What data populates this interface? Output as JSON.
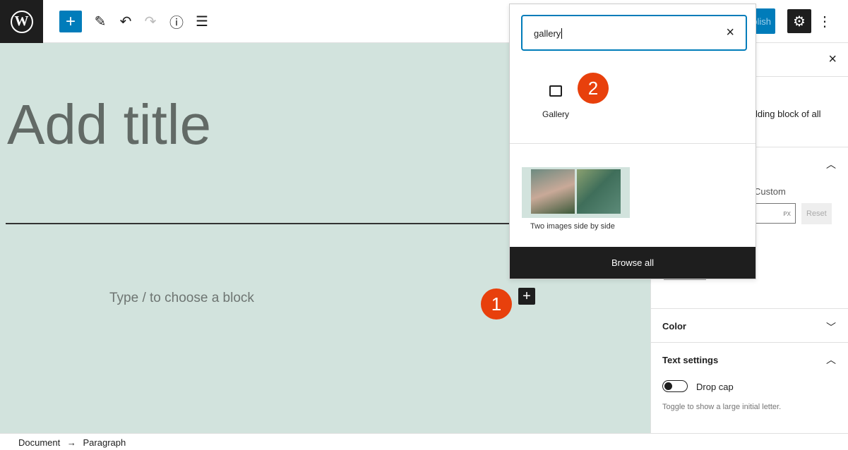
{
  "toolbar": {
    "logo": "W",
    "add": "+",
    "edit": "✎",
    "undo": "↶",
    "redo": "↷",
    "info": "ⓘ",
    "list": "☰",
    "publish": "Publish",
    "settings": "⚙",
    "more": "⋮"
  },
  "editor": {
    "title_placeholder": "Add title",
    "block_placeholder": "Type / to choose a block",
    "inserter": "+",
    "badge1": "1",
    "badge2": "2"
  },
  "inserter": {
    "search_value": "gallery",
    "clear": "×",
    "block_label": "Gallery",
    "pattern_label": "Two images side by side",
    "browse_all": "Browse all"
  },
  "sidebar": {
    "close": "×",
    "desc_fragment": "lding block of all",
    "custom": "Custom",
    "unit": "PX",
    "reset": "Reset",
    "color": "Color",
    "text_settings": "Text settings",
    "drop_cap": "Drop cap",
    "drop_cap_help": "Toggle to show a large initial letter."
  },
  "breadcrumb": {
    "document": "Document",
    "arrow": "→",
    "paragraph": "Paragraph"
  }
}
